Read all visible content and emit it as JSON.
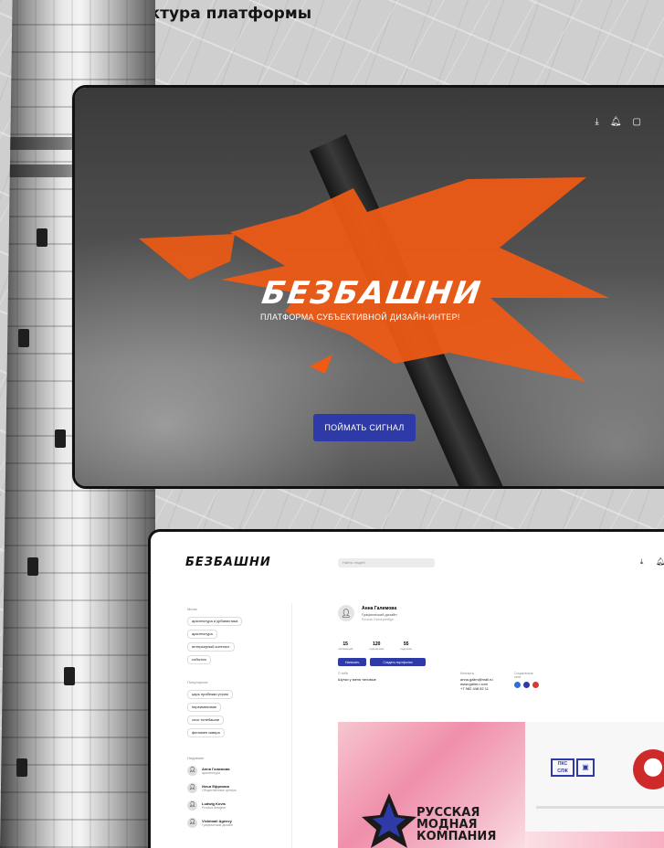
{
  "caption": "Структура платформы",
  "hero": {
    "logo": "БЕЗБАШНИ",
    "tagline": "ПЛАТФОРМА СУБЪЕКТИВНОЙ ДИЗАЙН-ИНТЕР!",
    "cta_label": "ПОЙМАТЬ СИГНАЛ",
    "icons": [
      "download-icon",
      "bell-icon",
      "chat-icon"
    ],
    "accent_color": "#f05a13"
  },
  "dashboard": {
    "logo": "БЕЗБАШНИ",
    "search_placeholder": "Найти людей",
    "sections": {
      "sidebar_head_1": "Меню",
      "menu_items": [
        "архитектура и урбанистика",
        "архитектура",
        "интерьерный контекст",
        "события"
      ],
      "sidebar_head_2": "Популярное",
      "popular_items": [
        "царь пробежки утром",
        "переименован",
        "снос телебашни",
        "феномен сквера"
      ],
      "sidebar_head_3": "Недавние",
      "users": [
        {
          "name": "Анна Галимова",
          "role": "архитектура"
        },
        {
          "name": "Илья Ефремов",
          "role": "Общественные центры"
        },
        {
          "name": "Ludwig Kovis",
          "role": "Product designer"
        },
        {
          "name": "Vividmail Agency",
          "role": "Графический дизайн"
        }
      ]
    },
    "profile": {
      "name": "Анна Галимова",
      "role": "Графический дизайн",
      "location": "Россия, Екатеринбург",
      "stats": [
        {
          "value": "15",
          "label": "публикаций"
        },
        {
          "value": "120",
          "label": "подписчики"
        },
        {
          "value": "55",
          "label": "подписки"
        }
      ],
      "btn_primary": "Написать",
      "btn_secondary": "Создать портфолио",
      "about_head": "О себе",
      "about_text": "Шутки у меня типовые",
      "contacts_head": "Контакты",
      "email": "anna.galim@mail.ru",
      "site": "www.galim.r.com",
      "phone": "+7 982 448 82 11",
      "social_head": "Социальные сети"
    },
    "gallery": {
      "brand_lines": [
        "РУССКАЯ",
        "МОДНАЯ",
        "КОМПАНИЯ"
      ],
      "mark_text": "ПКС СЛЖ"
    }
  }
}
